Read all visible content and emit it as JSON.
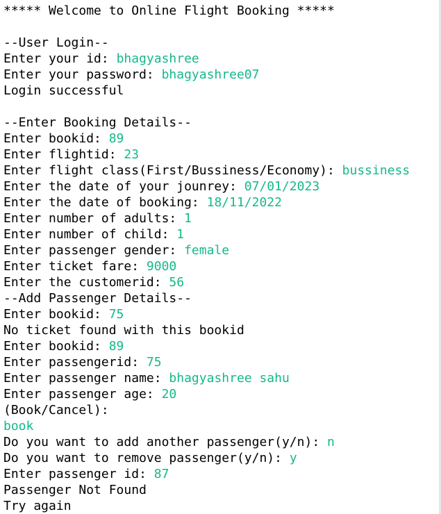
{
  "colors": {
    "background": "#ffffff",
    "text": "#000000",
    "user_input": "#13b98a"
  },
  "console": {
    "lines": [
      {
        "prompt": "***** Welcome to Online Flight Booking *****",
        "input": ""
      },
      {
        "prompt": "",
        "input": ""
      },
      {
        "prompt": "--User Login--",
        "input": ""
      },
      {
        "prompt": "Enter your id: ",
        "input": "bhagyashree"
      },
      {
        "prompt": "Enter your password: ",
        "input": "bhagyashree07"
      },
      {
        "prompt": "Login successful",
        "input": ""
      },
      {
        "prompt": "",
        "input": ""
      },
      {
        "prompt": "--Enter Booking Details--",
        "input": ""
      },
      {
        "prompt": "Enter bookid: ",
        "input": "89"
      },
      {
        "prompt": "Enter flightid: ",
        "input": "23"
      },
      {
        "prompt": "Enter flight class(First/Bussiness/Economy): ",
        "input": "bussiness"
      },
      {
        "prompt": "Enter the date of your jounrey: ",
        "input": "07/01/2023"
      },
      {
        "prompt": "Enter the date of booking: ",
        "input": "18/11/2022"
      },
      {
        "prompt": "Enter number of adults: ",
        "input": "1"
      },
      {
        "prompt": "Enter number of child: ",
        "input": "1"
      },
      {
        "prompt": "Enter passenger gender: ",
        "input": "female"
      },
      {
        "prompt": "Enter ticket fare: ",
        "input": "9000"
      },
      {
        "prompt": "Enter the customerid: ",
        "input": "56"
      },
      {
        "prompt": "--Add Passenger Details--",
        "input": ""
      },
      {
        "prompt": "Enter bookid: ",
        "input": "75"
      },
      {
        "prompt": "No ticket found with this bookid",
        "input": ""
      },
      {
        "prompt": "Enter bookid: ",
        "input": "89"
      },
      {
        "prompt": "Enter passengerid: ",
        "input": "75"
      },
      {
        "prompt": "Enter passenger name: ",
        "input": "bhagyashree sahu"
      },
      {
        "prompt": "Enter passenger age: ",
        "input": "20"
      },
      {
        "prompt": "(Book/Cancel):",
        "input": ""
      },
      {
        "prompt": "",
        "input": "book"
      },
      {
        "prompt": "Do you want to add another passenger(y/n): ",
        "input": "n"
      },
      {
        "prompt": "Do you want to remove passenger(y/n): ",
        "input": "y"
      },
      {
        "prompt": "Enter passenger id: ",
        "input": "87"
      },
      {
        "prompt": "Passenger Not Found",
        "input": ""
      },
      {
        "prompt": "Try again",
        "input": ""
      }
    ]
  }
}
